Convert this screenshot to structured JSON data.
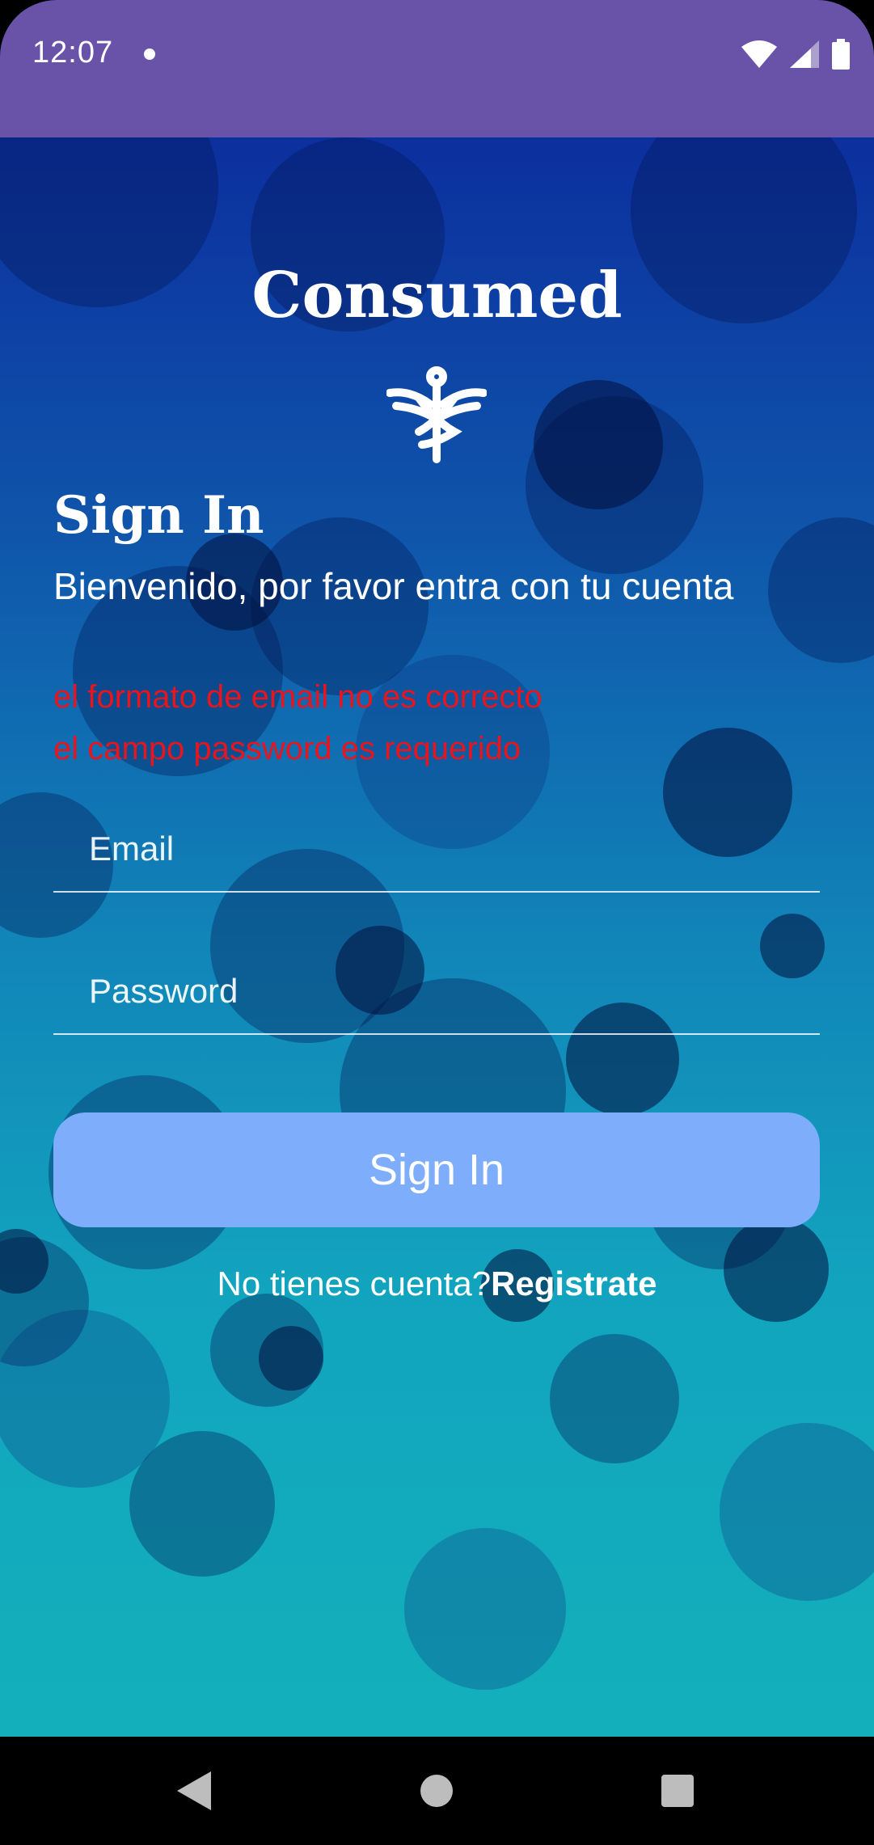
{
  "status_bar": {
    "time": "12:07",
    "icons": [
      "notification-dot-icon",
      "wifi-icon",
      "signal-icon",
      "battery-icon"
    ]
  },
  "app": {
    "title": "Consumed",
    "logo_icon": "caduceus-icon"
  },
  "signin": {
    "heading": "Sign In",
    "subtitle": "Bienvenido, por favor entra con tu cuenta",
    "errors": [
      "el formato de email no es correcto",
      "el campo password es requerido"
    ],
    "email": {
      "placeholder": "Email",
      "value": ""
    },
    "password": {
      "placeholder": "Password",
      "value": ""
    },
    "button_label": "Sign In",
    "register_prompt": "No tienes cuenta?",
    "register_link": "Registrate"
  },
  "navigation": {
    "back_icon": "back-triangle-icon",
    "home_icon": "home-circle-icon",
    "recents_icon": "recents-square-icon"
  },
  "colors": {
    "status_bar": "#6953a8",
    "error": "#e8141e",
    "button": "#7eaefb",
    "gradient_top": "#0c2f9e",
    "gradient_bottom": "#13b0bc"
  }
}
